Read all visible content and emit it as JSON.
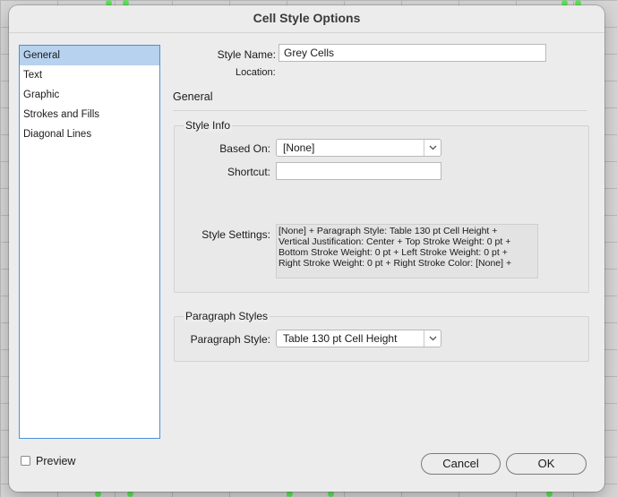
{
  "dialog": {
    "title": "Cell Style Options"
  },
  "sidebar": {
    "items": [
      {
        "label": "General",
        "selected": true
      },
      {
        "label": "Text",
        "selected": false
      },
      {
        "label": "Graphic",
        "selected": false
      },
      {
        "label": "Strokes and Fills",
        "selected": false
      },
      {
        "label": "Diagonal Lines",
        "selected": false
      }
    ]
  },
  "form": {
    "style_name_label": "Style Name:",
    "style_name_value": "Grey Cells",
    "location_label": "Location:",
    "section_title": "General",
    "style_info": {
      "title": "Style Info",
      "based_on_label": "Based On:",
      "based_on_value": "[None]",
      "shortcut_label": "Shortcut:",
      "shortcut_value": "",
      "style_settings_label": "Style Settings:",
      "style_settings_lines": [
        "[None] + Paragraph Style: Table 130 pt Cell Height +",
        "Vertical Justification: Center + Top Stroke Weight: 0 pt +",
        "Bottom Stroke Weight: 0 pt + Left Stroke Weight: 0 pt +",
        "Right Stroke Weight: 0 pt + Right Stroke Color: [None] +"
      ]
    },
    "paragraph_styles": {
      "title": "Paragraph Styles",
      "paragraph_style_label": "Paragraph Style:",
      "paragraph_style_value": "Table 130 pt Cell Height"
    }
  },
  "footer": {
    "preview_label": "Preview",
    "preview_checked": false,
    "cancel_label": "Cancel",
    "ok_label": "OK"
  },
  "colors": {
    "selection": "#b6d2ee",
    "list_border": "#4a90d9",
    "dialog_bg": "#ececec"
  }
}
